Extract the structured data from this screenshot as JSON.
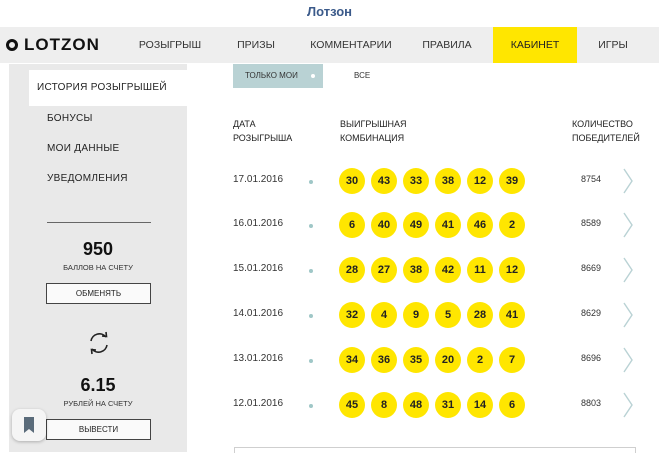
{
  "window": {
    "title": "Лотзон"
  },
  "logo": {
    "text": "LOTZON"
  },
  "nav": {
    "items": [
      {
        "label": "Розыгрыш",
        "active": false
      },
      {
        "label": "Призы",
        "active": false
      },
      {
        "label": "Комментарии",
        "active": false
      },
      {
        "label": "Правила",
        "active": false
      },
      {
        "label": "Кабинет",
        "active": true
      },
      {
        "label": "Игры",
        "active": false
      }
    ]
  },
  "sidebar": {
    "menu": [
      {
        "label": "История розыгрышей",
        "active": true
      },
      {
        "label": "Бонусы",
        "active": false
      },
      {
        "label": "Мои данные",
        "active": false
      },
      {
        "label": "Уведомления",
        "active": false
      }
    ],
    "points": {
      "value": "950",
      "label": "Баллов на счету",
      "button": "Обменять"
    },
    "balance": {
      "value": "6.15",
      "label": "Рублей на счету",
      "button": "Вывести"
    }
  },
  "filters": {
    "mine": "Только мои",
    "all": "Все"
  },
  "table": {
    "headers": {
      "date": [
        "Дата",
        "розыгрыша"
      ],
      "combination": [
        "Выигрышная",
        "комбинация"
      ],
      "winners": [
        "Количество",
        "победителей"
      ]
    },
    "rows": [
      {
        "date": "17.01.2016",
        "numbers": [
          "30",
          "43",
          "33",
          "38",
          "12",
          "39"
        ],
        "winners": "8754"
      },
      {
        "date": "16.01.2016",
        "numbers": [
          "6",
          "40",
          "49",
          "41",
          "46",
          "2"
        ],
        "winners": "8589"
      },
      {
        "date": "15.01.2016",
        "numbers": [
          "28",
          "27",
          "38",
          "42",
          "11",
          "12"
        ],
        "winners": "8669"
      },
      {
        "date": "14.01.2016",
        "numbers": [
          "32",
          "4",
          "9",
          "5",
          "28",
          "41"
        ],
        "winners": "8629"
      },
      {
        "date": "13.01.2016",
        "numbers": [
          "34",
          "36",
          "35",
          "20",
          "2",
          "7"
        ],
        "winners": "8696"
      },
      {
        "date": "12.01.2016",
        "numbers": [
          "45",
          "8",
          "48",
          "31",
          "14",
          "6"
        ],
        "winners": "8803"
      }
    ]
  },
  "colors": {
    "accent": "#ffe600",
    "filter_active": "#b9d2d4",
    "sidebar": "#e9e9e9",
    "dot": "#9fc7c7"
  },
  "icons": {
    "refresh": "refresh-icon",
    "chevron": "chevron-right-icon",
    "bookmark": "bookmark-icon"
  }
}
